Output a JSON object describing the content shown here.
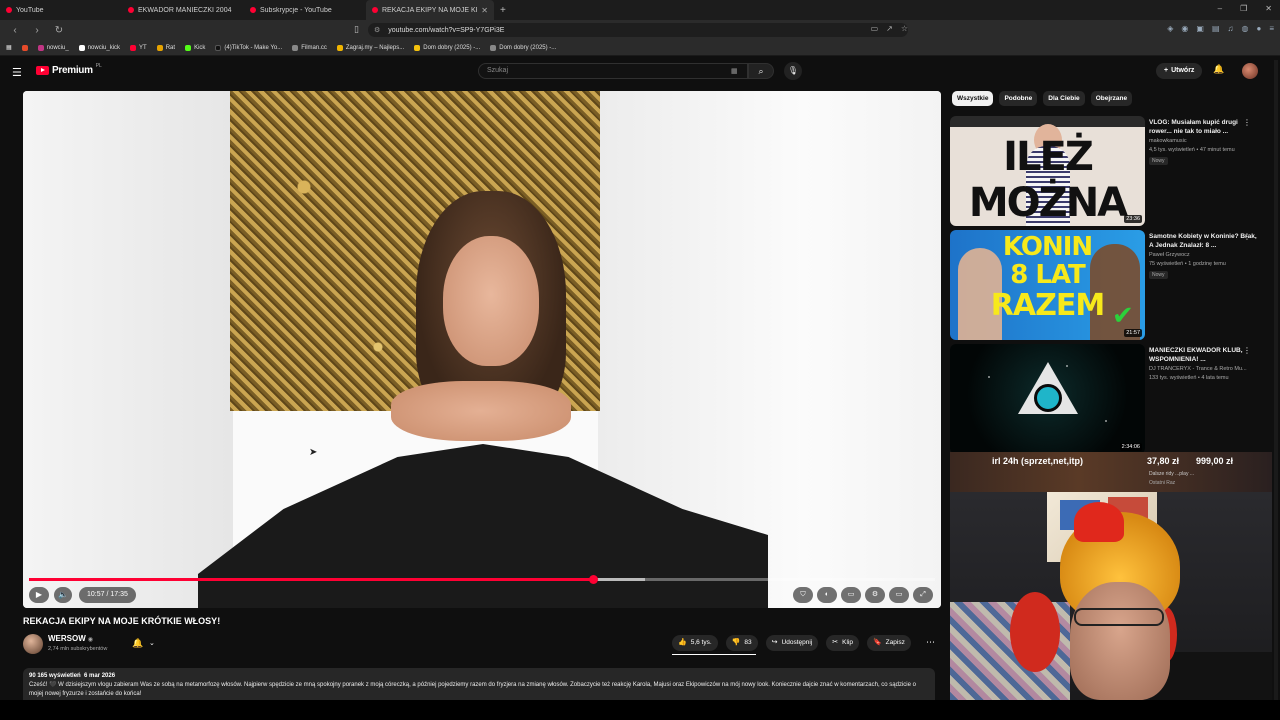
{
  "browser": {
    "tabs": [
      {
        "label": "YouTube",
        "active": false
      },
      {
        "label": "EKWADOR MANIECZKI 2004",
        "active": false
      },
      {
        "label": "Subskrypcje - YouTube",
        "active": false
      },
      {
        "label": "REKACJA EKIPY NA MOJE KRÓTK",
        "active": true
      }
    ],
    "url": "youtube.com/watch?v=SP9-Y7GPi3E",
    "bookmarks": [
      "nowciu_",
      "nowciu_kick",
      "YT",
      "Rat",
      "Kick",
      "(4)TikTok - Make Yo...",
      "Filman.cc",
      "Zagraj.my – Najleps...",
      "Dom dobry (2025) -...",
      "Dom dobry (2025) -..."
    ]
  },
  "header": {
    "logo_text": "Premium",
    "logo_region": "PL",
    "search_placeholder": "Szukaj",
    "create_label": "Utwórz"
  },
  "player": {
    "time_label": "10:57 / 17:35",
    "progress": 0.623,
    "buffered": 0.68
  },
  "video": {
    "title": "REKACJA EKIPY NA MOJE KRÓTKIE WŁOSY!",
    "channel": "WERSOW",
    "subscribers": "2,74 mln subskrybentów",
    "likes": "5,6 tys.",
    "dislikes": "83",
    "share_label": "Udostępnij",
    "clip_label": "Klip",
    "save_label": "Zapisz",
    "views": "90 165 wyświetleń",
    "date": "6 mar 2026",
    "description": "Cześć! 🖤 W dzisiejszym vlogu zabieram Was ze sobą na metamorfozę włosów. Najpierw spędzicie ze mną spokojny poranek z moją córeczką, a później pojedziemy razem do fryzjera na zmianę włosów. Zobaczycie też reakcję Karola, Majusi oraz Ekipowiczów na mój nowy look. Koniecznie dajcie znać w komentarzach, co sądzicie o mojej nowej fryzurze i zostańcie do końca!"
  },
  "sidebar": {
    "chips": [
      {
        "label": "Wszystkie",
        "active": true
      },
      {
        "label": "Podobne",
        "active": false
      },
      {
        "label": "Dla Ciebie",
        "active": false
      },
      {
        "label": "Obejrzane",
        "active": false
      }
    ],
    "recommendations": [
      {
        "title": "VLOG: Musiałam kupić drugi rower... nie tak to miało ...",
        "channel": "makowkamusic",
        "meta": "4,5 tys. wyświetleń • 47 minut temu",
        "badge": "Nowy",
        "duration": "23:36",
        "thumb_text": "ILEŻ MOŻNA"
      },
      {
        "title": "Samotne Kobiety w Koninie? Brak, A Jednak Znalazł: 8 ...",
        "channel": "Paweł Grzywocz",
        "meta": "75 wyświetleń • 1 godzinę temu",
        "badge": "Nowy",
        "duration": "21:57",
        "thumb_lines": [
          "KONIN",
          "8 LAT",
          "RAZEM"
        ]
      },
      {
        "title": "MANIECZKI EKWADOR KLUB, WSPOMNIENIA! ...",
        "channel": "DJ TRANCERYX - Trance & Retro Mu...",
        "meta": "133 tys. wyświetleń • 4 lata temu",
        "duration": "2:34:06"
      }
    ],
    "overlay": {
      "left": "irl 24h (sprzet,net,itp)",
      "mid": "37,80 zł",
      "right": "999,00 zł",
      "sub1": "Dalsze ridy ...play ...",
      "sub2": "Ostatni Raz"
    }
  },
  "colors": {
    "accent": "#ff0033",
    "background": "#0f0f0f",
    "chip_bg": "#272727"
  }
}
